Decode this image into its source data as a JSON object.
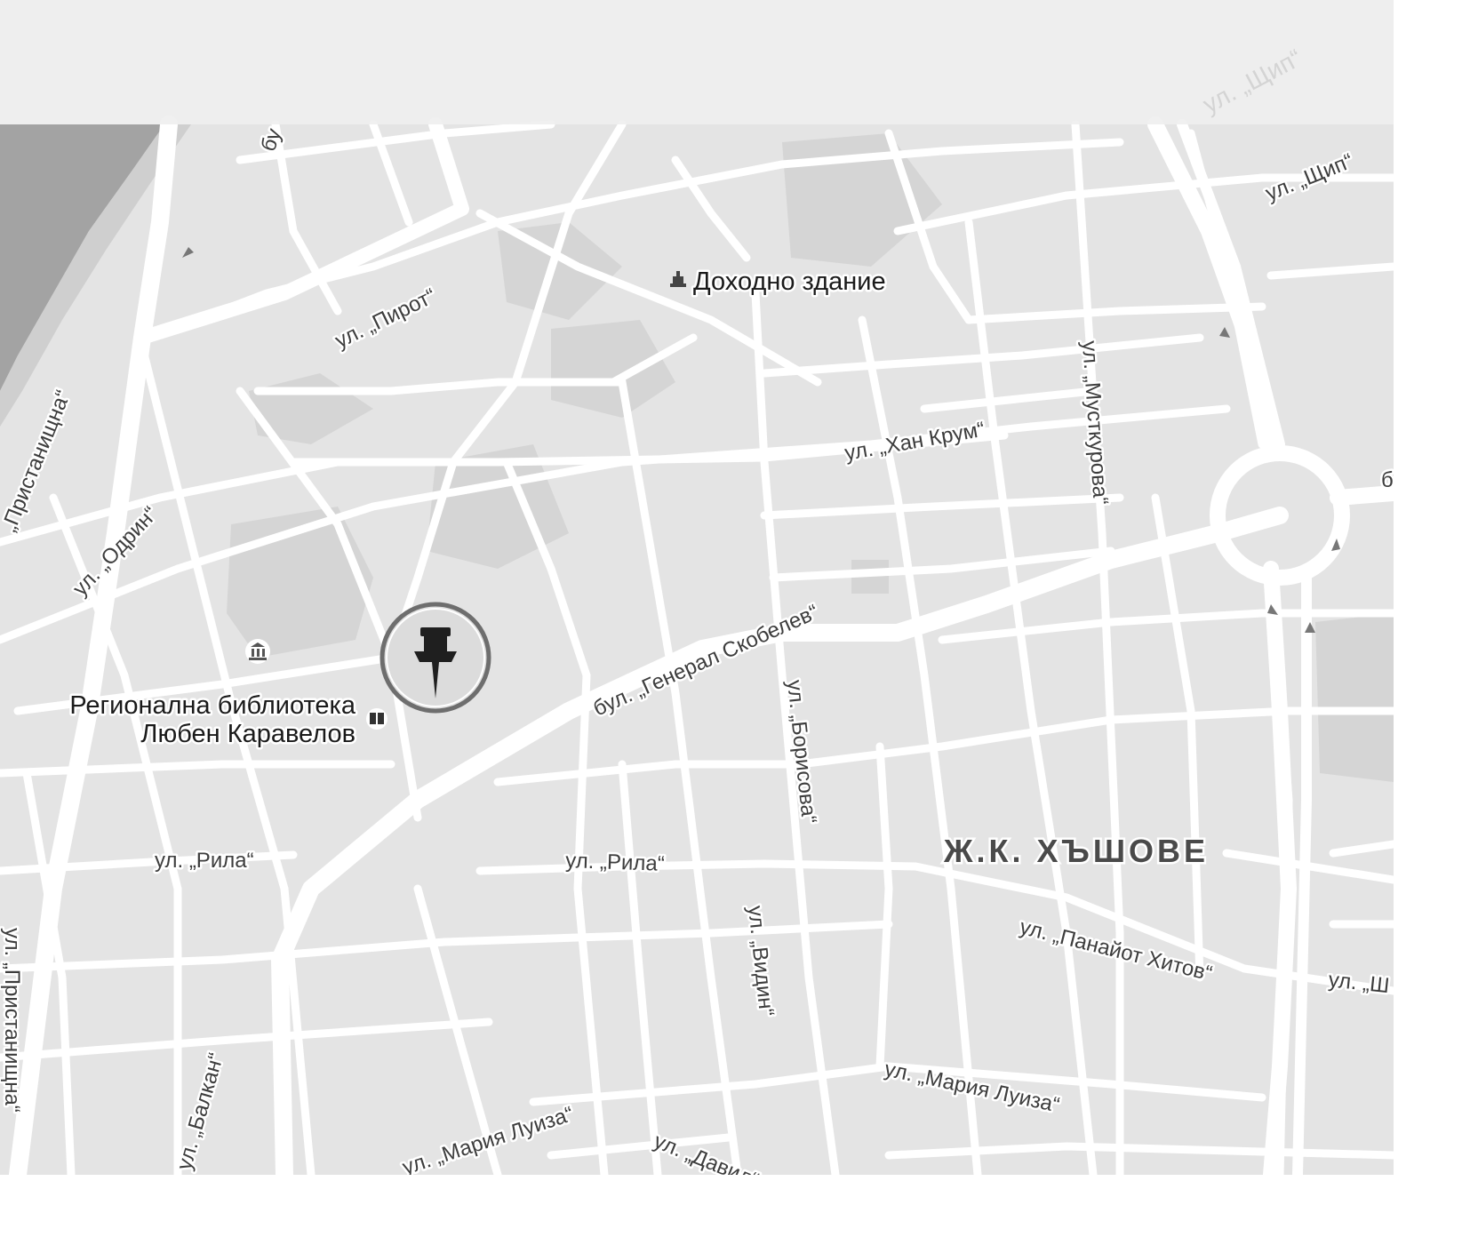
{
  "map": {
    "pin_icon": "pushpin-icon",
    "district": "Ж.К. ХЪШОВЕ",
    "pois": {
      "income_building": "Доходно здание",
      "library_line1": "Регионална библиотека",
      "library_line2": "Любен Каравелов"
    },
    "streets": {
      "pirot": "ул. „Пирот“",
      "pristanishtna": "„Пристанищна“",
      "odrin": "ул. „Одрин“",
      "han_krum": "ул. „Хан Крум“",
      "mutkurova": "ул. „Мусткурова“",
      "shtip": "ул. „Щип“",
      "shtip_faded": "ул. „Щип“",
      "skobelev": "бул. „Генерал Скобелев“",
      "borisova": "ул. „Борисова“",
      "rila_left": "ул. „Рила“",
      "rila_center": "ул. „Рила“",
      "vidin": "ул. „Видин“",
      "panayot": "ул. „Панайот Хитов“",
      "sh_right": "ул. „Ш",
      "pristanishtna_lower": "ул. „Пристанищна“",
      "balkan": "ул. „Балкан“",
      "maria_luiza_left": "ул. „Мария Луиза“",
      "maria_luiza_right": "ул. „Мария Луиза“",
      "david": "ул. „Давид“",
      "bul_top": "бу",
      "b_right": "б"
    },
    "colors": {
      "background": "#e4e4e4",
      "road": "#ffffff",
      "river": "#a3a3a3",
      "park": "#d3d3d3",
      "label": "#3d3d3d"
    }
  }
}
